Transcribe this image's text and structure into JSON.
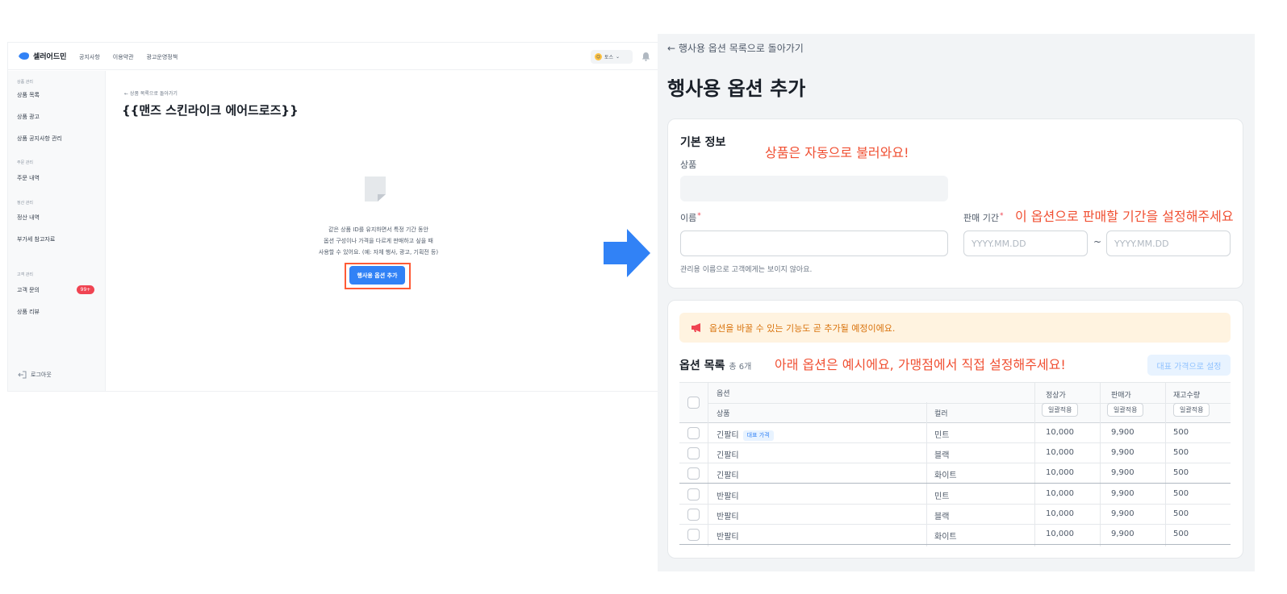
{
  "left_app": {
    "logo_text": "셀러어드민",
    "nav": [
      "공지사항",
      "이용약관",
      "광고운영정책"
    ],
    "user_label": "토스",
    "sidebar": {
      "groups": [
        {
          "label": "상품 관리",
          "items": [
            "상품 목록",
            "상품 광고",
            "상품 공지사항 관리"
          ]
        },
        {
          "label": "주문 관리",
          "items": [
            "주문 내역"
          ]
        },
        {
          "label": "정산 관리",
          "items": [
            "정산 내역",
            "부가세 참고자료"
          ]
        },
        {
          "label": "고객 관리",
          "items": [
            "고객 문의",
            "상품 리뷰"
          ]
        }
      ],
      "inquiry_badge": "99+",
      "logout": "로그아웃"
    },
    "main": {
      "back_link": "← 상품 목록으로 돌아가기",
      "title": "{{맨즈 스킨라이크 에어드로즈}}",
      "empty_desc": [
        "같은 상품 ID를 유지하면서 특정 기간 동안",
        "옵션 구성이나 가격을 다르게 판매하고 싶을 때",
        "사용할 수 있어요. (예: 자체 행사, 광고, 기획전 등)"
      ],
      "cta": "행사용 옵션 추가"
    }
  },
  "right_app": {
    "back_link": "← 행사용 옵션 목록으로 돌아가기",
    "title": "행사용 옵션 추가",
    "basic_info": {
      "heading": "기본 정보",
      "annotation": "상품은 자동으로 불러와요!",
      "product_label": "상품",
      "product_value": "",
      "name_label": "이름",
      "name_value": "",
      "name_hint": "관리용 이름으로 고객에게는 보이지 않아요.",
      "period_label": "판매 기간",
      "period_annotation": "이 옵션으로 판매할 기간을 설정해주세요",
      "start_placeholder": "YYYY.MM.DD",
      "end_placeholder": "YYYY.MM.DD",
      "tilde": "~"
    },
    "options": {
      "alert": "옵션을 바꿀 수 있는 기능도 곧 추가될 예정이에요.",
      "title": "옵션 목록",
      "count": "총 6개",
      "annotation": "아래 옵션은 예시에요, 가맹점에서 직접 설정해주세요!",
      "rep_price_button": "대표 가격으로 설정",
      "header": {
        "option": "옵션",
        "product": "상품",
        "color": "컬러",
        "regular_price": "정상가",
        "sale_price": "판매가",
        "stock": "재고수량",
        "bulk_apply": "일괄적용"
      },
      "rep_tag": "대표 가격",
      "rows": [
        {
          "product": "긴팔티",
          "color": "민트",
          "regular": "10,000",
          "sale": "9,900",
          "stock": "500"
        },
        {
          "product": "긴팔티",
          "color": "블랙",
          "regular": "10,000",
          "sale": "9,900",
          "stock": "500"
        },
        {
          "product": "긴팔티",
          "color": "화이트",
          "regular": "10,000",
          "sale": "9,900",
          "stock": "500"
        },
        {
          "product": "반팔티",
          "color": "민트",
          "regular": "10,000",
          "sale": "9,900",
          "stock": "500"
        },
        {
          "product": "반팔티",
          "color": "블랙",
          "regular": "10,000",
          "sale": "9,900",
          "stock": "500"
        },
        {
          "product": "반팔티",
          "color": "화이트",
          "regular": "10,000",
          "sale": "9,900",
          "stock": "500"
        }
      ]
    }
  },
  "colors": {
    "primary": "#3182f6",
    "annotation": "#f04f32",
    "badge": "#f04452",
    "alert_bg": "#fff3e0",
    "alert_text": "#d9730d"
  }
}
